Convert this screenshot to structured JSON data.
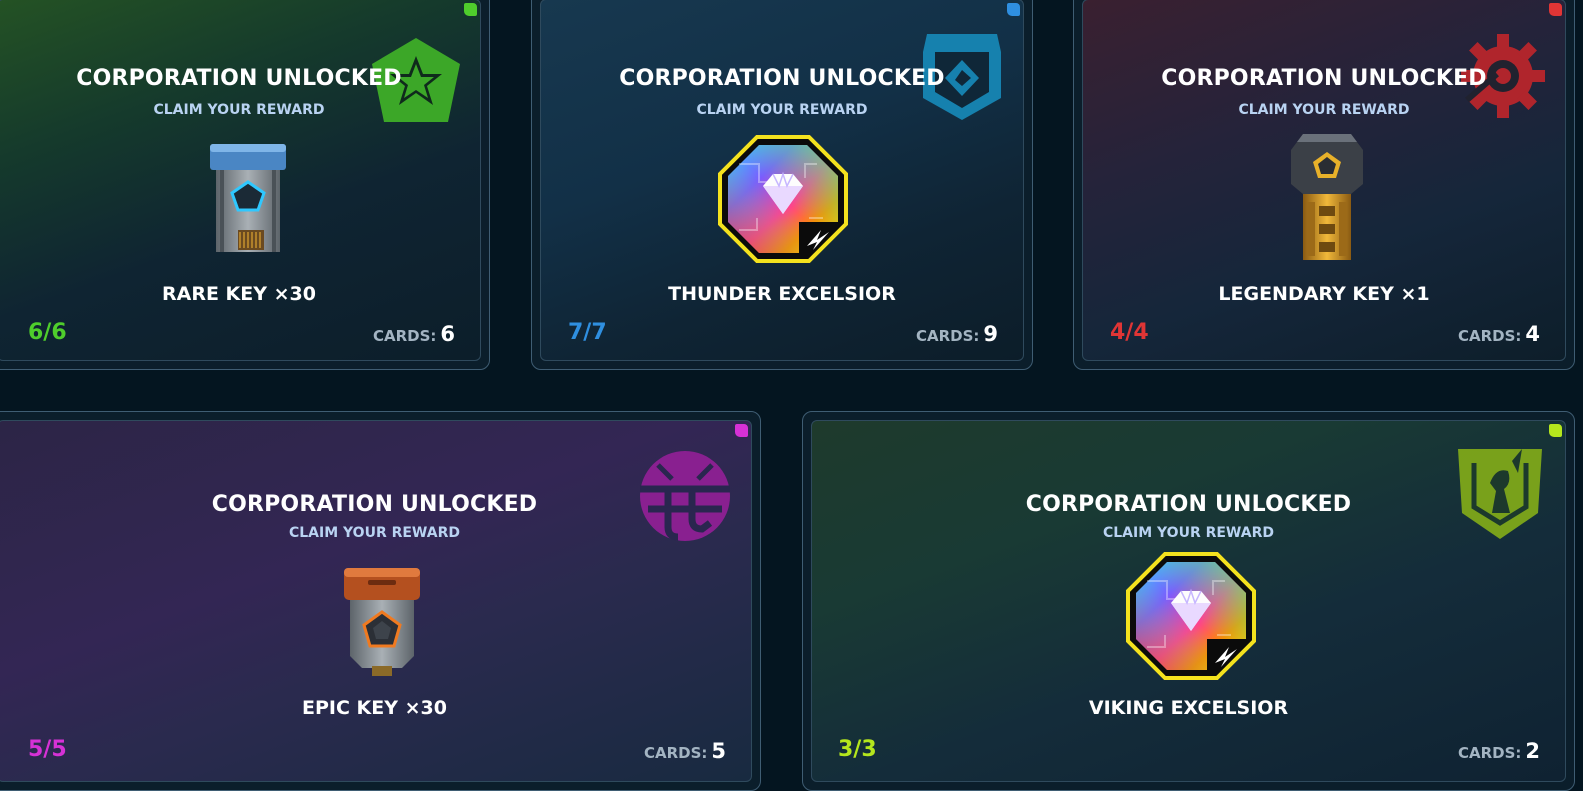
{
  "colors": {
    "background": "#041520",
    "green": "#4fce2c",
    "blue": "#2f8fe0",
    "red": "#e03535",
    "magenta": "#d631d6",
    "lime": "#b5e61d"
  },
  "cards": [
    {
      "title": "CORPORATION UNLOCKED",
      "subtitle": "CLAIM YOUR REWARD",
      "reward": "RARE KEY ×30",
      "reward_icon": "rare-key-icon",
      "emblem_icon": "star-shield-emblem-icon",
      "progress": "6/6",
      "cards_label": "CARDS:",
      "cards_value": "6",
      "accent": "#4fce2c"
    },
    {
      "title": "CORPORATION UNLOCKED",
      "subtitle": "CLAIM YOUR REWARD",
      "reward": "THUNDER EXCELSIOR",
      "reward_icon": "rainbow-diamond-badge-icon",
      "emblem_icon": "hex-diamond-emblem-icon",
      "progress": "7/7",
      "cards_label": "CARDS:",
      "cards_value": "9",
      "accent": "#2f8fe0"
    },
    {
      "title": "CORPORATION UNLOCKED",
      "subtitle": "CLAIM YOUR REWARD",
      "reward": "LEGENDARY KEY ×1",
      "reward_icon": "legendary-key-icon",
      "emblem_icon": "gear-emblem-icon",
      "progress": "4/4",
      "cards_label": "CARDS:",
      "cards_value": "4",
      "accent": "#e03535"
    },
    {
      "title": "CORPORATION UNLOCKED",
      "subtitle": "CLAIM YOUR REWARD",
      "reward": "EPIC KEY ×30",
      "reward_icon": "epic-key-icon",
      "emblem_icon": "globe-emblem-icon",
      "progress": "5/5",
      "cards_label": "CARDS:",
      "cards_value": "5",
      "accent": "#d631d6"
    },
    {
      "title": "CORPORATION UNLOCKED",
      "subtitle": "CLAIM YOUR REWARD",
      "reward": "VIKING EXCELSIOR",
      "reward_icon": "rainbow-diamond-badge-icon",
      "emblem_icon": "warrior-shield-emblem-icon",
      "progress": "3/3",
      "cards_label": "CARDS:",
      "cards_value": "2",
      "accent": "#b5e61d"
    }
  ]
}
